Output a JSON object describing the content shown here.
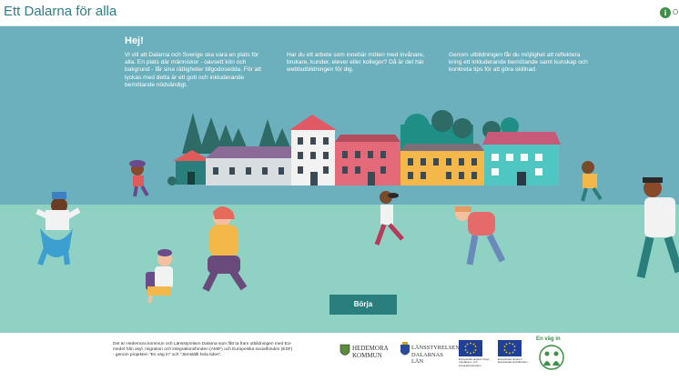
{
  "header": {
    "title": "Ett Dalarna för alla",
    "info_icon_glyph": "i",
    "info_label": "O"
  },
  "intro": {
    "heading": "Hej!",
    "col1": "Vi vill att Dalarna och Sverige ska vara en plats för alla. En plats där människor - oavsett kön och bakgrund - får sina rättigheter tillgodosedda. För att lyckas med detta är ett gott och inkluderande bemötande nödvändigt.",
    "col2": "Har du ett arbete som innebär möten med invånare, brukare, kunder, elever eller kollegor? Då är det här webbutbildningen för dig.",
    "col3": "Genom utbildningen får du möjlighet att reflektera kring ett inkluderande bemötande samt kunskap och konkreta tips för att göra skillnad."
  },
  "start_button": {
    "label": "Börja"
  },
  "footer": {
    "text": "Det är Hedemora kommun och Länsstyrelsen Dalarna som fått ta fram utbildningen med EU-medel från asyl, migration och integrationsfonden (AMIF) och Europeiska socialfonden (ESF) - genom projekten \"En väg in\" och \"Jämställt hela tiden\".",
    "logos": {
      "hedemora_line1": "HEDEMORA",
      "hedemora_line2": "KOMMUN",
      "lansstyrelsen_line1": "LÄNSSTYRELSEN",
      "lansstyrelsen_line2": "DALARNAS LÄN",
      "eu_caption_1": "Europeiska unionen Asyl-, migrations- och integrationsfonden",
      "eu_caption_2": "Europeiska unionen Europeiska socialfonden",
      "envagin": "En väg in"
    }
  },
  "colors": {
    "sky": "#6cb0bd",
    "ground": "#8fd1c3",
    "title": "#2c7f88",
    "button": "#2a7f7c",
    "eu_blue": "#1f3f99"
  }
}
